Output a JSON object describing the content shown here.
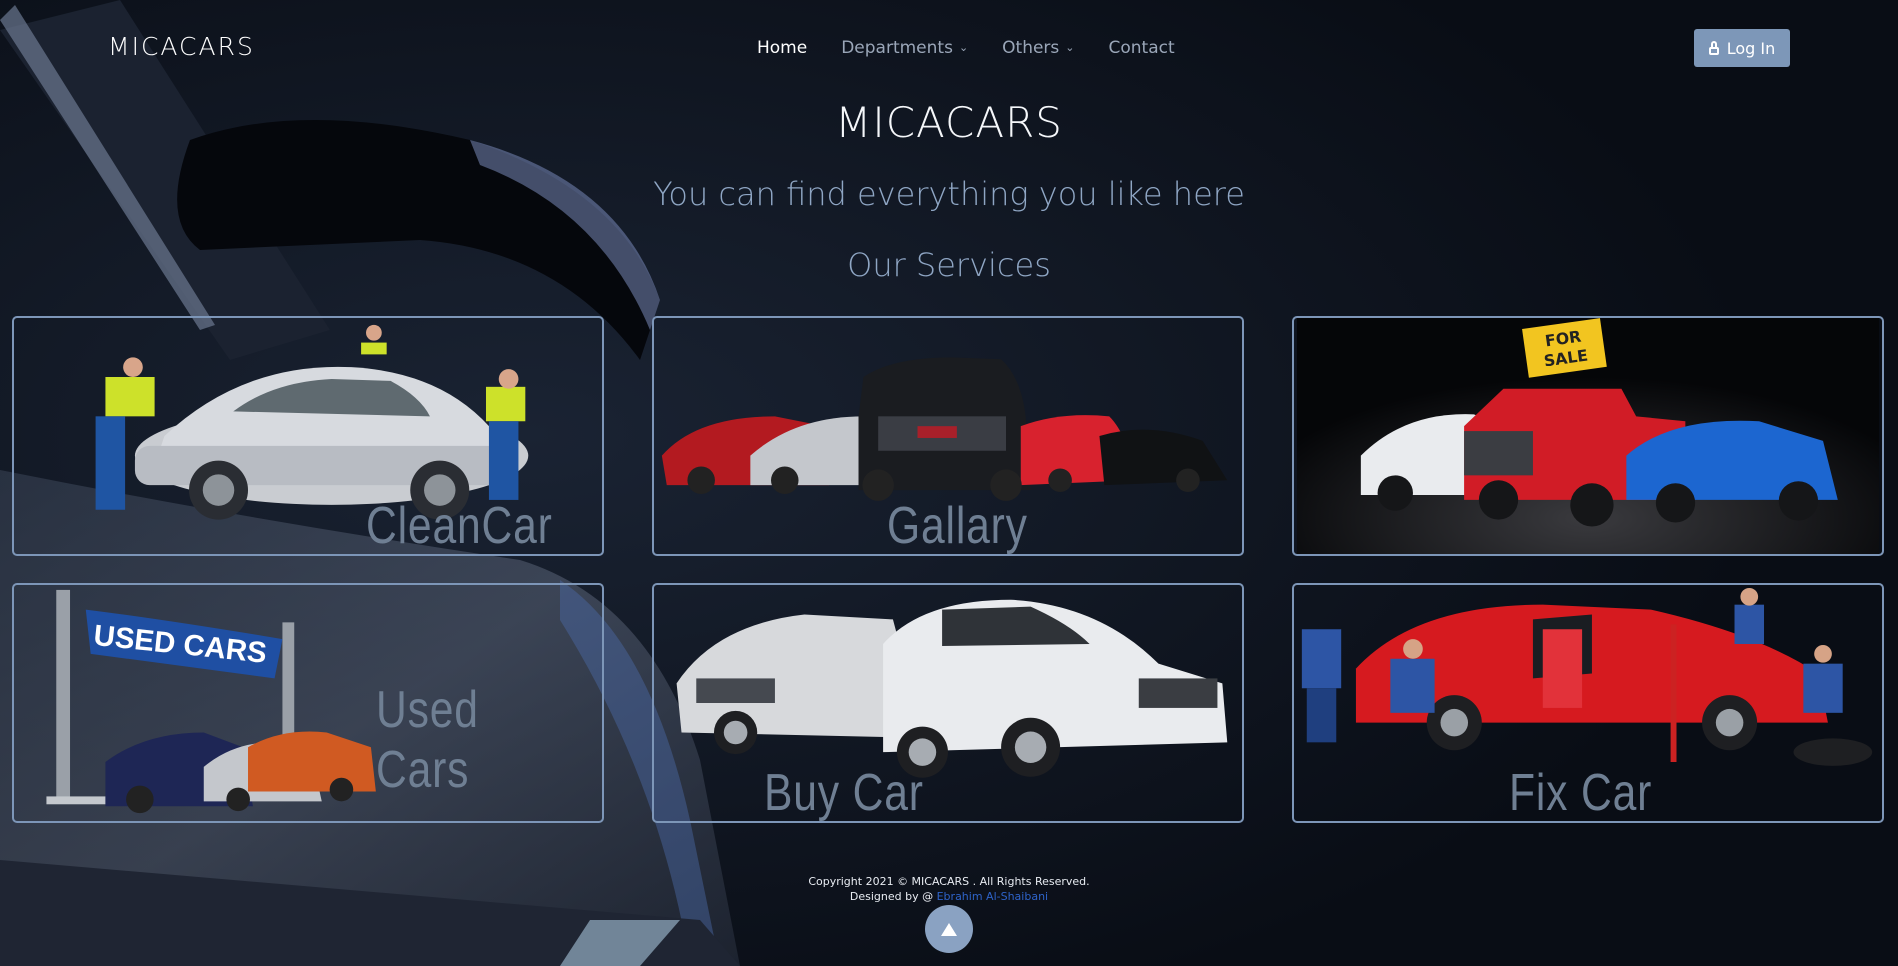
{
  "brand": "MICACARS",
  "nav": {
    "items": [
      {
        "label": "Home",
        "active": true
      },
      {
        "label": "Departments",
        "dropdown": true
      },
      {
        "label": "Others",
        "dropdown": true
      },
      {
        "label": "Contact"
      }
    ],
    "login_label": "Log In"
  },
  "hero": {
    "title": "MICACARS",
    "subtitle": "You can find everything you like here",
    "services_heading": "Our Services"
  },
  "services": [
    {
      "label": "CleanCar",
      "icon": "car-wash-image"
    },
    {
      "label": "Gallary",
      "icon": "car-lineup-image"
    },
    {
      "label": "",
      "icon": "for-sale-image"
    },
    {
      "label": "Used  Cars",
      "icon": "used-cars-banner-image"
    },
    {
      "label": "Buy  Car",
      "icon": "white-cars-image"
    },
    {
      "label": "Fix  Car",
      "icon": "car-repair-image"
    }
  ],
  "footer": {
    "copyright": "Copyright 2021 © MICACARS . All Rights Reserved.",
    "designed_prefix": "Designed by @",
    "designer": "Ebrahim Al-Shaibani"
  },
  "colors": {
    "background": "#0b1019",
    "accent": "#7d97b8",
    "muted_text": "#8fa6c4",
    "link": "#2e63c8"
  }
}
